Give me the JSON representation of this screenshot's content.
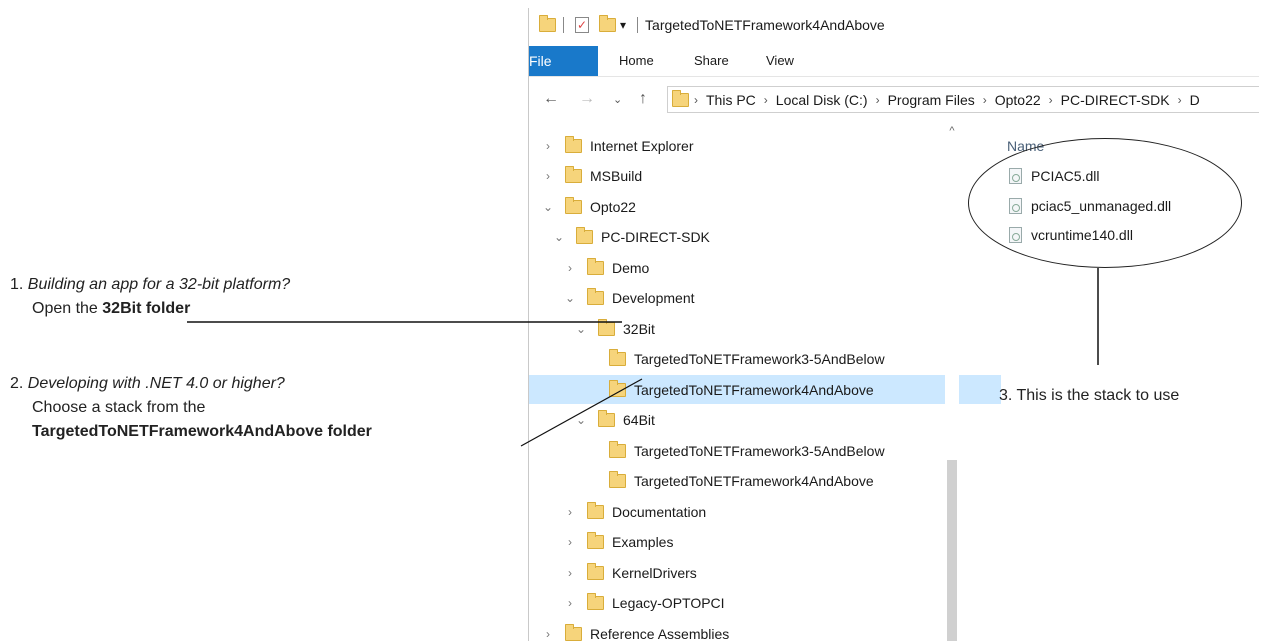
{
  "annotations": {
    "step1_prefix": "1.",
    "step1_question": "Building an app for a 32-bit platform?",
    "step1_action": "Open the",
    "step1_bold": "32Bit folder",
    "step2_prefix": "2.",
    "step2_question": "Developing with .NET 4.0 or higher?",
    "step2_action": "Choose a stack from the",
    "step2_bold": "TargetedToNETFramework4AndAbove folder",
    "step3": "3. This is the stack to use"
  },
  "window": {
    "title": "TargetedToNETFramework4AndAbove",
    "ribbon_tabs": [
      "File",
      "Home",
      "Share",
      "View"
    ],
    "breadcrumb": [
      "This PC",
      "Local Disk (C:)",
      "Program Files",
      "Opto22",
      "PC-DIRECT-SDK",
      "D"
    ]
  },
  "tree": [
    {
      "label": "Internet Explorer",
      "depth": 0,
      "expanded": false
    },
    {
      "label": "MSBuild",
      "depth": 0,
      "expanded": false
    },
    {
      "label": "Opto22",
      "depth": 0,
      "expanded": true
    },
    {
      "label": "PC-DIRECT-SDK",
      "depth": 1,
      "expanded": true
    },
    {
      "label": "Demo",
      "depth": 2,
      "expanded": false
    },
    {
      "label": "Development",
      "depth": 2,
      "expanded": true
    },
    {
      "label": "32Bit",
      "depth": 3,
      "expanded": true
    },
    {
      "label": "TargetedToNETFramework3-5AndBelow",
      "depth": 4,
      "expanded": null
    },
    {
      "label": "TargetedToNETFramework4AndAbove",
      "depth": 4,
      "expanded": null,
      "selected": true
    },
    {
      "label": "64Bit",
      "depth": 3,
      "expanded": true
    },
    {
      "label": "TargetedToNETFramework3-5AndBelow",
      "depth": 4,
      "expanded": null
    },
    {
      "label": "TargetedToNETFramework4AndAbove",
      "depth": 4,
      "expanded": null
    },
    {
      "label": "Documentation",
      "depth": 2,
      "expanded": false
    },
    {
      "label": "Examples",
      "depth": 2,
      "expanded": false
    },
    {
      "label": "KernelDrivers",
      "depth": 2,
      "expanded": false
    },
    {
      "label": "Legacy-OPTOPCI",
      "depth": 2,
      "expanded": false
    },
    {
      "label": "Reference Assemblies",
      "depth": 0,
      "expanded": false
    }
  ],
  "file_pane": {
    "column_header": "Name",
    "files": [
      "PCIAC5.dll",
      "pciac5_unmanaged.dll",
      "vcruntime140.dll"
    ]
  },
  "colors": {
    "file_tab": "#1979ca",
    "selection": "#cce8ff",
    "folder": "#f6d47b"
  }
}
